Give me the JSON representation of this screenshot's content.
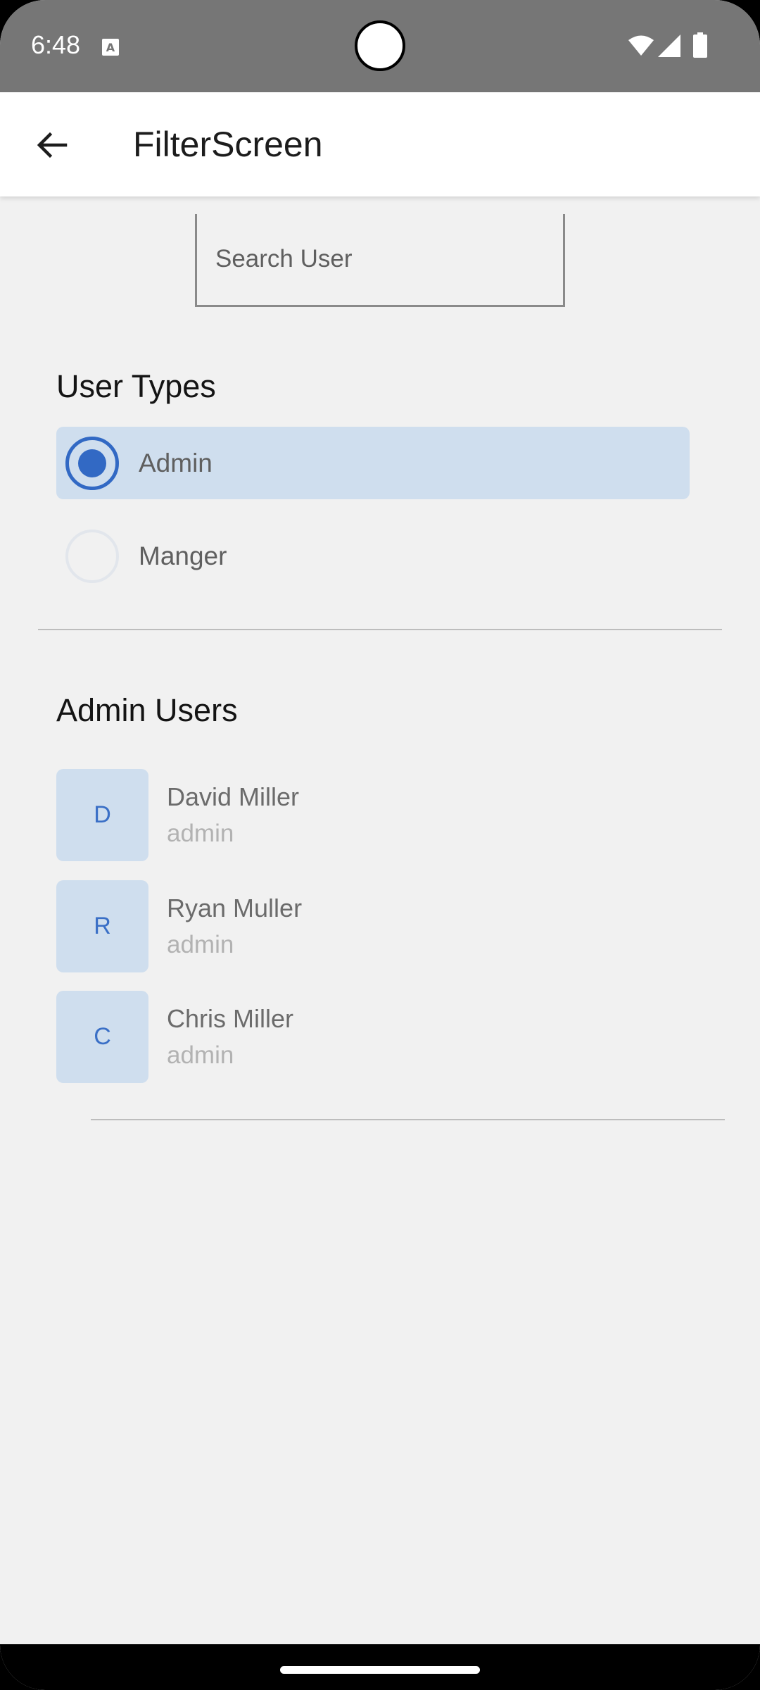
{
  "status_bar": {
    "time": "6:48",
    "icons": [
      "text-a-icon",
      "wifi-icon",
      "signal-icon",
      "battery-icon"
    ]
  },
  "app_bar": {
    "back_icon": "arrow-left-icon",
    "title": "FilterScreen"
  },
  "search": {
    "placeholder": "Search User",
    "value": ""
  },
  "user_types": {
    "title": "User Types",
    "options": [
      {
        "label": "Admin",
        "selected": true
      },
      {
        "label": "Manger",
        "selected": false
      }
    ]
  },
  "admin_users": {
    "title": "Admin Users",
    "users": [
      {
        "initial": "D",
        "name": "David Miller",
        "role": "admin"
      },
      {
        "initial": "R",
        "name": "Ryan Muller",
        "role": "admin"
      },
      {
        "initial": "C",
        "name": "Chris Miller",
        "role": "admin"
      }
    ]
  },
  "colors": {
    "status_bar_bg": "#767676",
    "app_bar_bg": "#ffffff",
    "screen_bg": "#f1f1f1",
    "accent": "#3269c4",
    "selected_row_bg": "#cfdeee"
  }
}
